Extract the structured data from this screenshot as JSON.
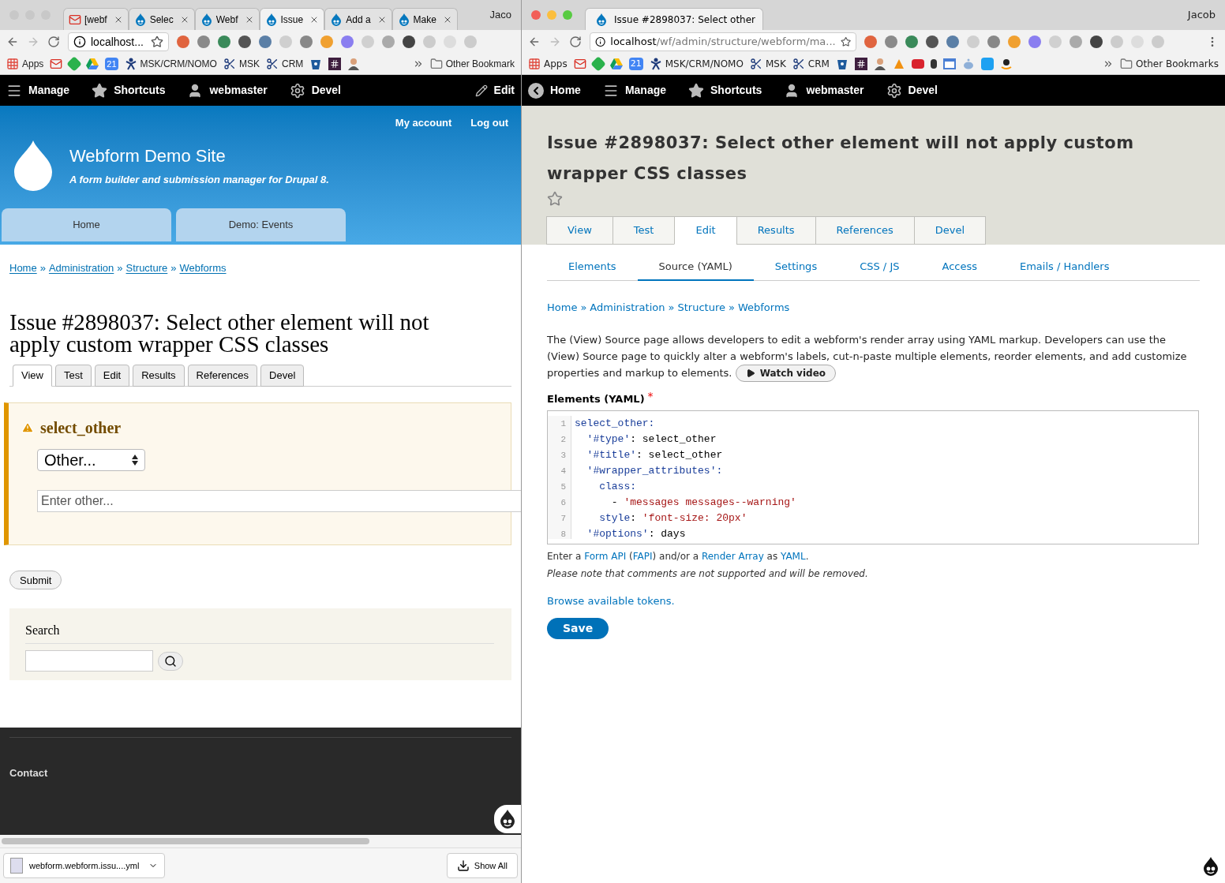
{
  "left_window": {
    "tabs": [
      {
        "title": "[webf",
        "kind": "gmail",
        "selected": false
      },
      {
        "title": "Selec",
        "kind": "drupal",
        "selected": false
      },
      {
        "title": "Webf",
        "kind": "drupal",
        "selected": false
      },
      {
        "title": "Issue",
        "kind": "drupal",
        "selected": true
      },
      {
        "title": "Add a",
        "kind": "drupal",
        "selected": false
      },
      {
        "title": "Make",
        "kind": "drupal",
        "selected": false
      }
    ],
    "profile": "Jaco",
    "address": "localhost...",
    "bookmarks": [
      {
        "kind": "apps",
        "label": "Apps"
      },
      {
        "kind": "gmail"
      },
      {
        "kind": "feedly"
      },
      {
        "kind": "drive"
      },
      {
        "kind": "calendar",
        "label": "21"
      },
      {
        "kind": "tools",
        "label": "MSK/CRM/NOMO"
      },
      {
        "kind": "scissors",
        "label": "MSK"
      },
      {
        "kind": "scissors",
        "label": "CRM"
      },
      {
        "kind": "bucket"
      },
      {
        "kind": "slack"
      },
      {
        "kind": "avatar"
      }
    ],
    "other_bookmarks": "Other Bookmark",
    "toolbar": [
      {
        "kind": "menu",
        "label": "Manage"
      },
      {
        "kind": "star",
        "label": "Shortcuts"
      },
      {
        "kind": "user",
        "label": "webmaster"
      },
      {
        "kind": "gear",
        "label": "Devel"
      }
    ],
    "toolbar_edit": "Edit",
    "user_links": [
      "My account",
      "Log out"
    ],
    "site_name": "Webform Demo Site",
    "slogan": "A form builder and submission manager for Drupal 8.",
    "nav": [
      "Home",
      "Demo: Events"
    ],
    "breadcrumb": [
      "Home",
      "Administration",
      "Structure",
      "Webforms"
    ],
    "breadcrumb_separator": "»",
    "title": "Issue #2898037: Select other element will not apply custom wrapper CSS classes",
    "local_tabs": [
      {
        "label": "View",
        "selected": true
      },
      {
        "label": "Test",
        "selected": false
      },
      {
        "label": "Edit",
        "selected": false
      },
      {
        "label": "Results",
        "selected": false
      },
      {
        "label": "References",
        "selected": false
      },
      {
        "label": "Devel",
        "selected": false
      }
    ],
    "form": {
      "label": "select_other",
      "select_value": "Other...",
      "other_placeholder": "Enter other...",
      "submit": "Submit"
    },
    "search_title": "Search",
    "footer_links": [
      "Contact"
    ],
    "download": {
      "file": "webform.webform.issu....yml",
      "show_all": "Show All"
    }
  },
  "right_window": {
    "tab": {
      "title": "Issue #2898037: Select other",
      "selected": true
    },
    "profile": "Jacob",
    "address_host": "localhost",
    "address_path": "/wf/admin/structure/webform/ma...",
    "bookmarks": [
      {
        "kind": "apps",
        "label": "Apps"
      },
      {
        "kind": "gmail"
      },
      {
        "kind": "feedly"
      },
      {
        "kind": "drive"
      },
      {
        "kind": "calendar",
        "label": "21"
      },
      {
        "kind": "tools",
        "label": "MSK/CRM/NOMO"
      },
      {
        "kind": "scissors",
        "label": "MSK"
      },
      {
        "kind": "scissors",
        "label": "CRM"
      },
      {
        "kind": "bucket"
      },
      {
        "kind": "slack"
      },
      {
        "kind": "avatar"
      },
      {
        "kind": "pma"
      },
      {
        "kind": "flag"
      },
      {
        "kind": "small"
      },
      {
        "kind": "window"
      },
      {
        "kind": "reddit"
      },
      {
        "kind": "twitter"
      },
      {
        "kind": "amazon"
      }
    ],
    "other_bookmarks": "Other Bookmarks",
    "toolbar": [
      {
        "kind": "back",
        "label": "Home"
      },
      {
        "kind": "menu",
        "label": "Manage"
      },
      {
        "kind": "star",
        "label": "Shortcuts"
      },
      {
        "kind": "user",
        "label": "webmaster"
      },
      {
        "kind": "gear",
        "label": "Devel"
      }
    ],
    "title": "Issue #2898037: Select other element will not apply custom wrapper CSS classes",
    "primary_tabs": [
      {
        "label": "View",
        "selected": false
      },
      {
        "label": "Test",
        "selected": false
      },
      {
        "label": "Edit",
        "selected": true
      },
      {
        "label": "Results",
        "selected": false
      },
      {
        "label": "References",
        "selected": false
      },
      {
        "label": "Devel",
        "selected": false
      }
    ],
    "secondary_tabs": [
      {
        "label": "Elements",
        "selected": false
      },
      {
        "label": "Source (YAML)",
        "selected": true
      },
      {
        "label": "Settings",
        "selected": false
      },
      {
        "label": "CSS / JS",
        "selected": false
      },
      {
        "label": "Access",
        "selected": false
      },
      {
        "label": "Emails / Handlers",
        "selected": false
      }
    ],
    "breadcrumb": [
      "Home",
      "Administration",
      "Structure",
      "Webforms"
    ],
    "breadcrumb_separator": "»",
    "description": "The (View) Source page allows developers to edit a webform's render array using YAML markup. Developers can use the (View) Source page to quickly alter a webform's labels, cut-n-paste multiple elements, reorder elements, and add customize properties and markup to elements.",
    "watch_video": "Watch video",
    "field_label": "Elements (YAML)",
    "required_mark": "*",
    "code_lines": [
      {
        "number": "1",
        "parts": [
          {
            "t": "select_other:",
            "kind": "key"
          }
        ]
      },
      {
        "number": "2",
        "parts": [
          {
            "t": "  '#type'",
            "kind": "key"
          },
          {
            "t": ": select_other",
            "kind": "plain"
          }
        ]
      },
      {
        "number": "3",
        "parts": [
          {
            "t": "  '#title'",
            "kind": "key"
          },
          {
            "t": ": select_other",
            "kind": "plain"
          }
        ]
      },
      {
        "number": "4",
        "parts": [
          {
            "t": "  '#wrapper_attributes':",
            "kind": "key"
          }
        ]
      },
      {
        "number": "5",
        "parts": [
          {
            "t": "    class:",
            "kind": "key"
          }
        ]
      },
      {
        "number": "6",
        "parts": [
          {
            "t": "      - ",
            "kind": "plain"
          },
          {
            "t": "'messages messages--warning'",
            "kind": "string"
          }
        ]
      },
      {
        "number": "7",
        "parts": [
          {
            "t": "    style",
            "kind": "key"
          },
          {
            "t": ": ",
            "kind": "plain"
          },
          {
            "t": "'font-size: 20px'",
            "kind": "string"
          }
        ]
      },
      {
        "number": "8",
        "parts": [
          {
            "t": "  '#options'",
            "kind": "key"
          },
          {
            "t": ": days",
            "kind": "plain"
          }
        ]
      }
    ],
    "help": [
      {
        "t": "Enter a ",
        "kind": "text"
      },
      {
        "t": "Form API",
        "kind": "link"
      },
      {
        "t": " (",
        "kind": "text"
      },
      {
        "t": "FAPI",
        "kind": "link"
      },
      {
        "t": ") and/or a ",
        "kind": "text"
      },
      {
        "t": "Render Array",
        "kind": "link"
      },
      {
        "t": " as ",
        "kind": "text"
      },
      {
        "t": "YAML",
        "kind": "link"
      },
      {
        "t": ".",
        "kind": "text"
      }
    ],
    "note": "Please note that comments are not supported and will be removed.",
    "browse_tokens": "Browse available tokens.",
    "save": "Save"
  }
}
